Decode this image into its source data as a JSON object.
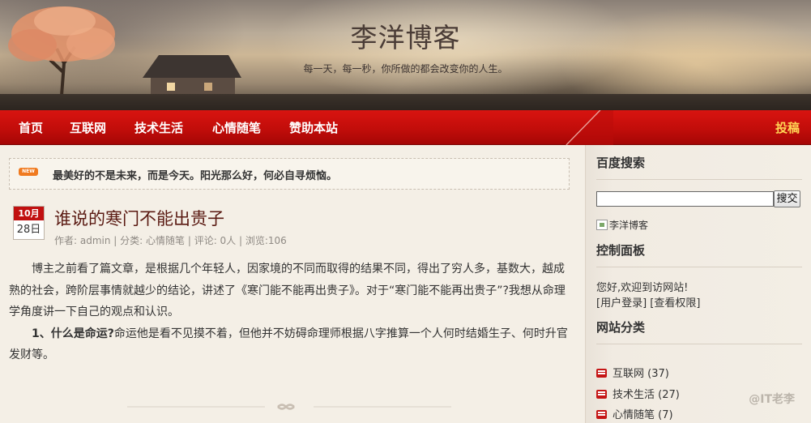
{
  "header": {
    "title": "李洋博客",
    "subtitle": "每一天，每一秒，你所做的都会改变你的人生。"
  },
  "nav": {
    "items": [
      "首页",
      "互联网",
      "技术生活",
      "心情随笔",
      "赞助本站"
    ],
    "submit_label": "投稿"
  },
  "notice": {
    "badge": "NEW",
    "text": "最美好的不是未来，而是今天。阳光那么好，何必自寻烦恼。"
  },
  "post": {
    "month": "10月",
    "day": "28日",
    "title": "谁说的寒门不能出贵子",
    "meta": {
      "author_prefix": "作者: ",
      "author": "admin",
      "category_prefix": " | 分类: ",
      "category": "心情随笔",
      "comments_prefix": " | 评论: ",
      "comments": "0人",
      "views_prefix": " | 浏览:",
      "views": "106"
    },
    "para1": "博主之前看了篇文章，是根据几个年轻人，因家境的不同而取得的结果不同，得出了穷人多，基数大，越成熟的社会，跨阶层事情就越少的结论，讲述了《寒门能不能再出贵子》。对于“寒门能不能再出贵子”?我想从命理学角度讲一下自己的观点和认识。",
    "para2_bold": "1、什么是命运?",
    "para2": "命运他是看不见摸不着，但他并不妨碍命理师根据八字推算一个人何时结婚生子、何时升官发财等。"
  },
  "sidebar": {
    "search_title": "百度搜索",
    "search_value": "",
    "search_button": "搜交",
    "image_alt": "李洋博客",
    "panel_title": "控制面板",
    "welcome": "您好,欢迎到访网站!",
    "login_link": "[用户登录]",
    "perm_link": "[查看权限]",
    "category_title": "网站分类",
    "categories": [
      {
        "label": "互联网 (37)"
      },
      {
        "label": "技术生活 (27)"
      },
      {
        "label": "心情随笔 (7)"
      }
    ]
  },
  "watermark": "@IT老李",
  "colors": {
    "nav_red": "#c20d0a",
    "nav_submit": "#ffd455",
    "date_red": "#c11010",
    "title_brown": "#5a1a12"
  }
}
